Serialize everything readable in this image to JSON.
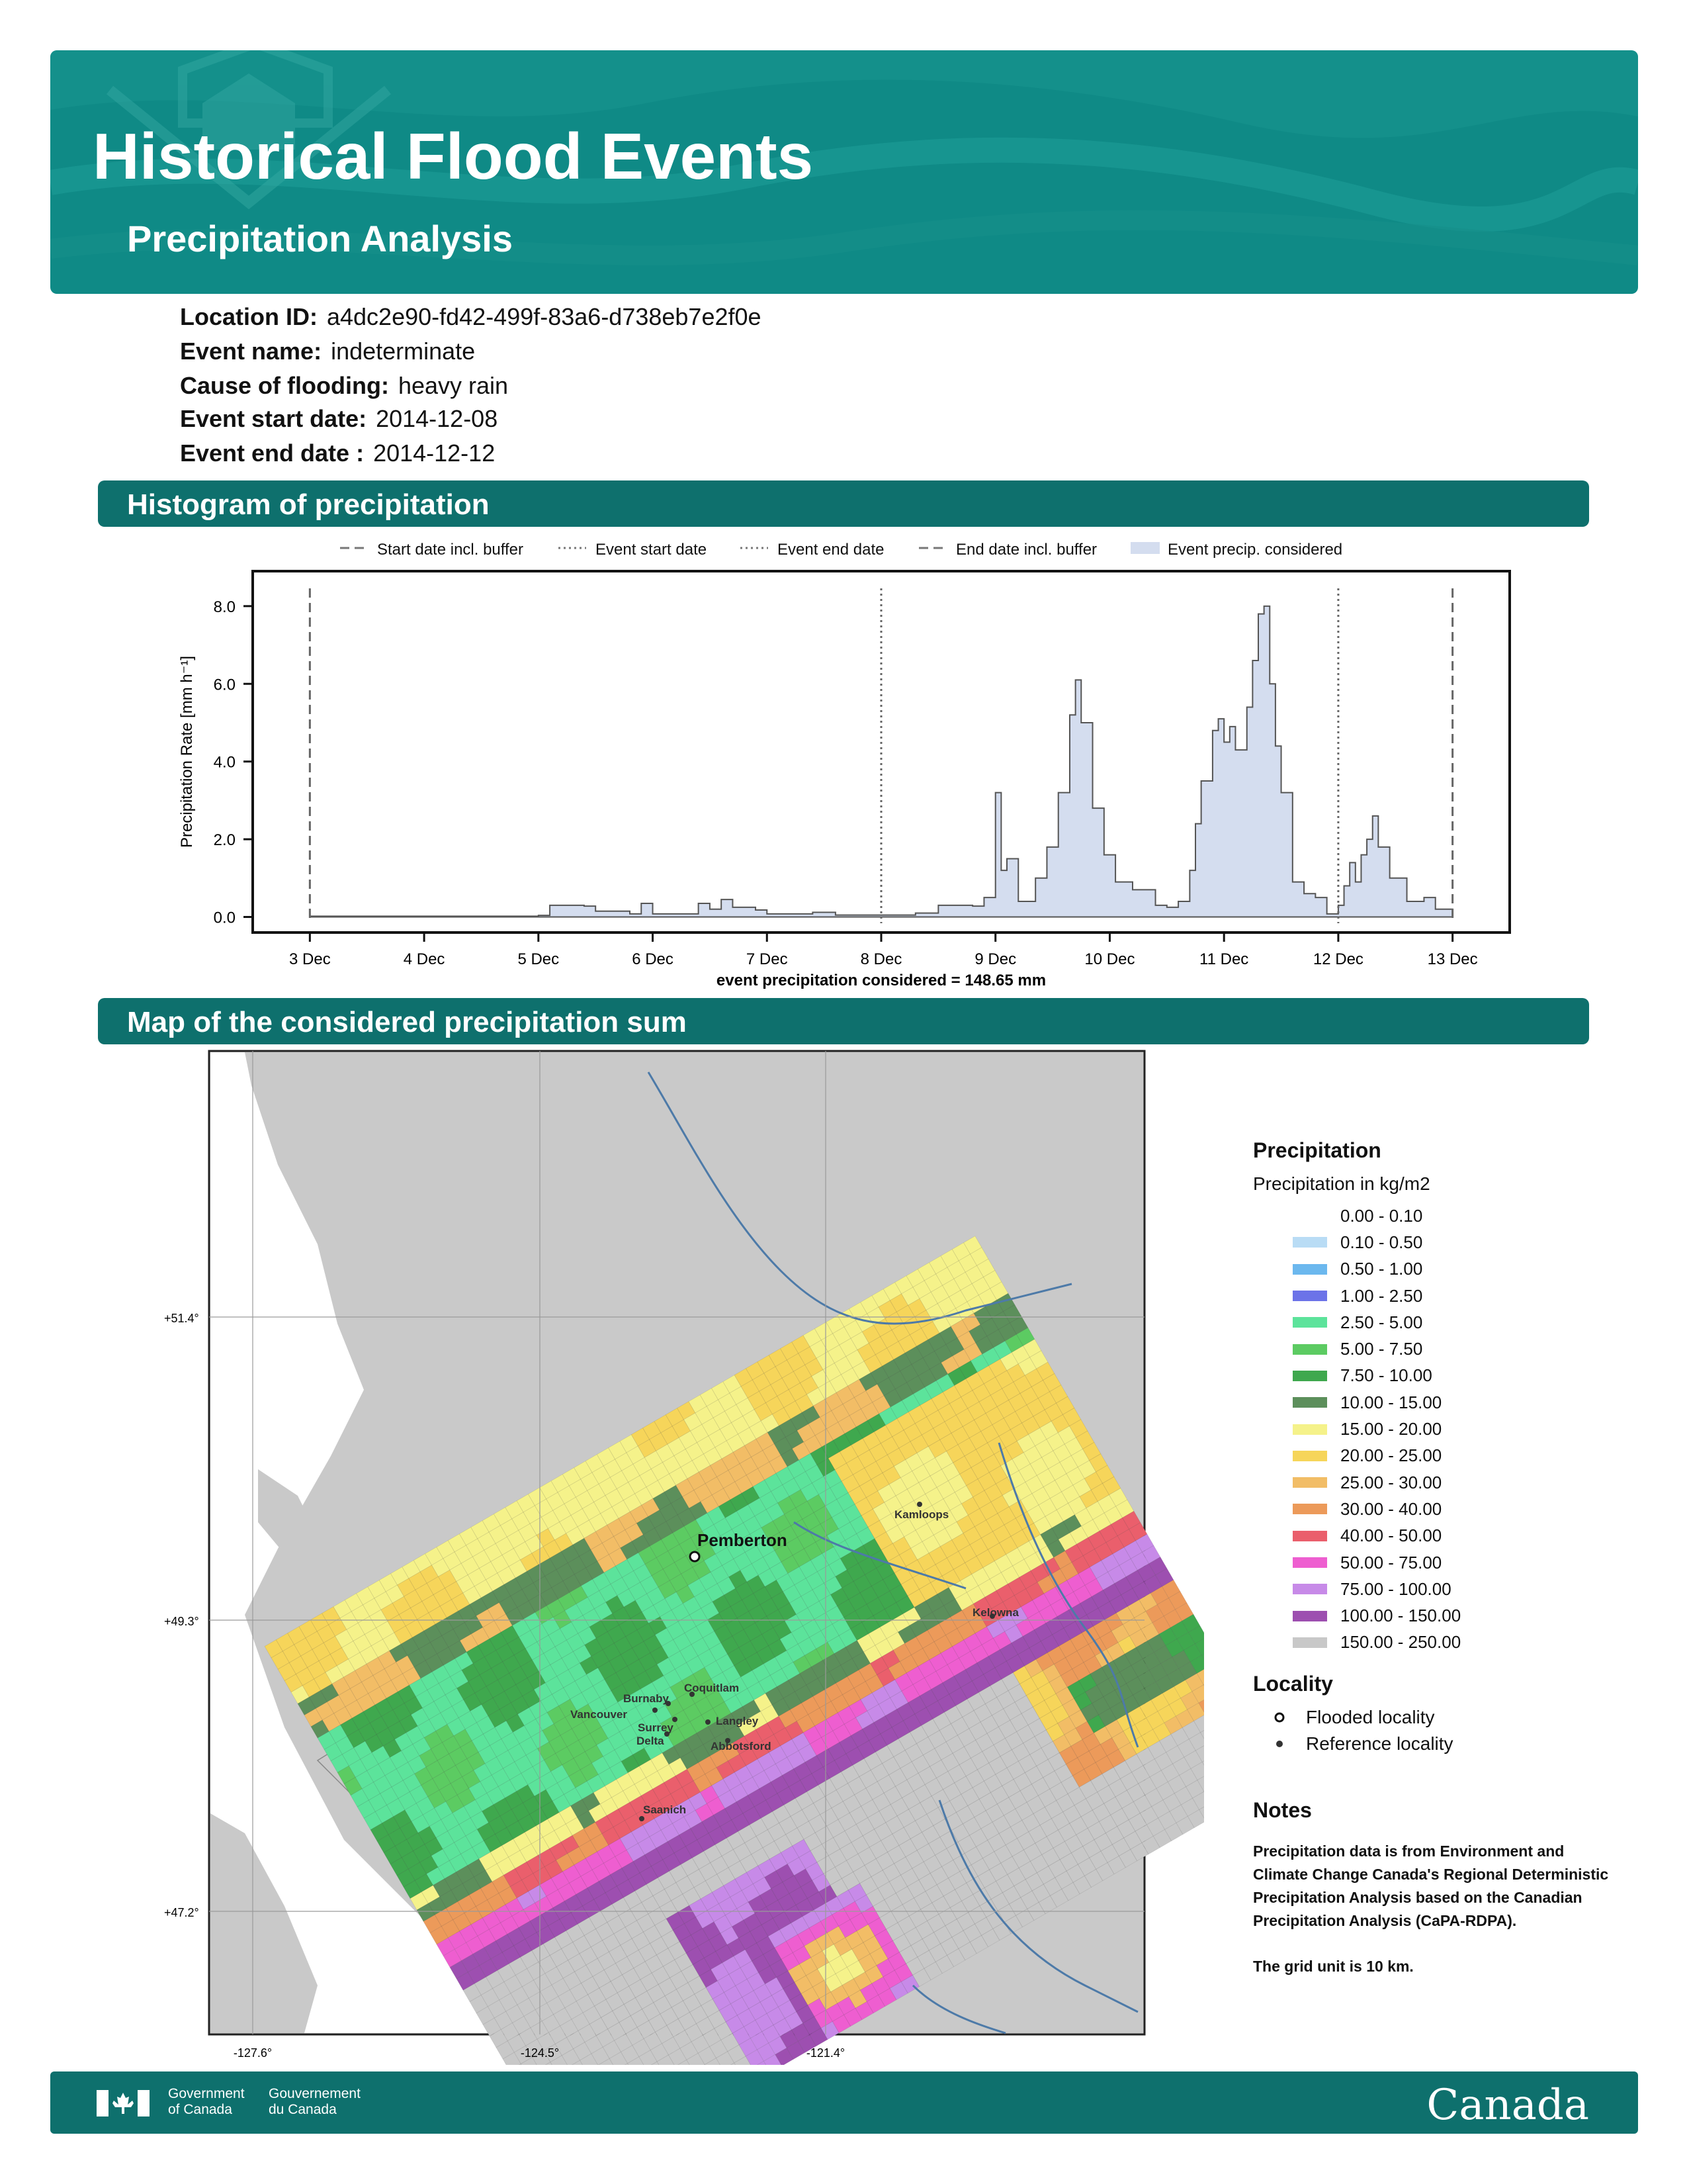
{
  "header": {
    "title": "Historical Flood Events",
    "subtitle": "Precipitation Analysis"
  },
  "event_info": [
    {
      "label": "Location ID:",
      "value": "a4dc2e90-fd42-499f-83a6-d738eb7e2f0e"
    },
    {
      "label": "Event name:",
      "value": "indeterminate"
    },
    {
      "label": "Cause of flooding:",
      "value": "heavy rain"
    },
    {
      "label": "Event start date:",
      "value": "2014-12-08"
    },
    {
      "label": "Event end date :",
      "value": "2014-12-12"
    }
  ],
  "sections": {
    "histogram": "Histogram of precipitation",
    "map": "Map of the considered precipitation sum"
  },
  "chart_data": {
    "type": "area",
    "legend": [
      "Start date incl. buffer",
      "Event start date",
      "Event end date",
      "End date incl. buffer",
      "Event precip. considered"
    ],
    "legend_position": "top",
    "ylabel": "Precipitation Rate [mm h⁻¹]",
    "xlabel": "event precipitation considered = 148.65 mm",
    "x_tick_labels": [
      "3 Dec",
      "4 Dec",
      "5 Dec",
      "6 Dec",
      "7 Dec",
      "8 Dec",
      "9 Dec",
      "10 Dec",
      "11 Dec",
      "12 Dec",
      "13 Dec"
    ],
    "y_tick_labels": [
      "0.0",
      "2.0",
      "4.0",
      "6.0",
      "8.0"
    ],
    "ylim": [
      -0.4,
      8.9
    ],
    "xlim": [
      -0.5,
      10.5
    ],
    "vlines": [
      {
        "label": "Start date incl. buffer",
        "day": 0,
        "style": "dashed"
      },
      {
        "label": "Event start date",
        "day": 5,
        "style": "dotted"
      },
      {
        "label": "Event end date",
        "day": 9,
        "style": "dotted"
      },
      {
        "label": "End date incl. buffer",
        "day": 10,
        "style": "dashed"
      }
    ],
    "series": [
      {
        "x_unit": "days from 3 Dec",
        "points": [
          [
            0,
            0.02
          ],
          [
            1,
            0.02
          ],
          [
            2,
            0.04
          ],
          [
            2.1,
            0.3
          ],
          [
            2.4,
            0.28
          ],
          [
            2.5,
            0.15
          ],
          [
            2.8,
            0.08
          ],
          [
            2.9,
            0.35
          ],
          [
            3.0,
            0.08
          ],
          [
            3.4,
            0.35
          ],
          [
            3.5,
            0.2
          ],
          [
            3.6,
            0.45
          ],
          [
            3.7,
            0.25
          ],
          [
            3.9,
            0.18
          ],
          [
            4.0,
            0.08
          ],
          [
            4.4,
            0.12
          ],
          [
            4.6,
            0.05
          ],
          [
            5,
            0.05
          ],
          [
            5.3,
            0.1
          ],
          [
            5.5,
            0.3
          ],
          [
            5.8,
            0.28
          ],
          [
            5.9,
            0.5
          ],
          [
            6.0,
            3.2
          ],
          [
            6.05,
            1.2
          ],
          [
            6.1,
            1.5
          ],
          [
            6.2,
            0.4
          ],
          [
            6.35,
            1.0
          ],
          [
            6.45,
            1.8
          ],
          [
            6.55,
            3.2
          ],
          [
            6.65,
            5.2
          ],
          [
            6.7,
            6.1
          ],
          [
            6.75,
            5.0
          ],
          [
            6.85,
            2.8
          ],
          [
            6.95,
            1.6
          ],
          [
            7.05,
            0.9
          ],
          [
            7.2,
            0.7
          ],
          [
            7.4,
            0.3
          ],
          [
            7.5,
            0.25
          ],
          [
            7.6,
            0.4
          ],
          [
            7.7,
            1.2
          ],
          [
            7.75,
            2.4
          ],
          [
            7.8,
            3.5
          ],
          [
            7.9,
            4.8
          ],
          [
            7.95,
            5.1
          ],
          [
            8.0,
            4.5
          ],
          [
            8.05,
            4.9
          ],
          [
            8.1,
            4.3
          ],
          [
            8.2,
            5.4
          ],
          [
            8.25,
            6.6
          ],
          [
            8.3,
            7.8
          ],
          [
            8.35,
            8.0
          ],
          [
            8.4,
            6.0
          ],
          [
            8.45,
            4.4
          ],
          [
            8.5,
            3.2
          ],
          [
            8.6,
            0.9
          ],
          [
            8.7,
            0.6
          ],
          [
            8.8,
            0.5
          ],
          [
            8.9,
            0.08
          ],
          [
            9.0,
            0.3
          ],
          [
            9.05,
            0.8
          ],
          [
            9.1,
            1.4
          ],
          [
            9.15,
            0.9
          ],
          [
            9.2,
            1.6
          ],
          [
            9.25,
            2.0
          ],
          [
            9.3,
            2.6
          ],
          [
            9.35,
            1.8
          ],
          [
            9.45,
            1.0
          ],
          [
            9.6,
            0.4
          ],
          [
            9.75,
            0.5
          ],
          [
            9.85,
            0.2
          ],
          [
            10,
            0.05
          ]
        ]
      }
    ]
  },
  "map": {
    "y_tick_labels": [
      "+51.4°",
      "+49.3°",
      "+47.2°"
    ],
    "x_tick_labels": [
      "-127.6°",
      "-124.5°",
      "-121.4°"
    ],
    "localities": [
      {
        "name": "Pemberton",
        "type": "flooded"
      },
      {
        "name": "Kamloops",
        "type": "reference"
      },
      {
        "name": "Kelowna",
        "type": "reference"
      },
      {
        "name": "Coquitlam",
        "type": "reference"
      },
      {
        "name": "Burnaby",
        "type": "reference"
      },
      {
        "name": "Vancouver",
        "type": "reference"
      },
      {
        "name": "Surrey",
        "type": "reference"
      },
      {
        "name": "Langley",
        "type": "reference"
      },
      {
        "name": "Delta",
        "type": "reference"
      },
      {
        "name": "Abbotsford",
        "type": "reference"
      },
      {
        "name": "Saanich",
        "type": "reference"
      }
    ]
  },
  "legend": {
    "title": "Precipitation",
    "subtitle": "Precipitation in kg/m2",
    "classes": [
      {
        "label": "0.00 - 0.10",
        "color": "#ffffff"
      },
      {
        "label": "0.10 - 0.50",
        "color": "#b9dcf5"
      },
      {
        "label": "0.50 - 1.00",
        "color": "#6cb8ee"
      },
      {
        "label": "1.00 - 2.50",
        "color": "#6c73e8"
      },
      {
        "label": "2.50 - 5.00",
        "color": "#5ce39b"
      },
      {
        "label": "5.00 - 7.50",
        "color": "#5ccb62"
      },
      {
        "label": "7.50 - 10.00",
        "color": "#3fa84e"
      },
      {
        "label": "10.00 - 15.00",
        "color": "#5c8f5b"
      },
      {
        "label": "15.00 - 20.00",
        "color": "#f5f28a"
      },
      {
        "label": "20.00 - 25.00",
        "color": "#f6d55a"
      },
      {
        "label": "25.00 - 30.00",
        "color": "#f2bd66"
      },
      {
        "label": "30.00 - 40.00",
        "color": "#ec9a5a"
      },
      {
        "label": "40.00 - 50.00",
        "color": "#ea5f6c"
      },
      {
        "label": "50.00 - 75.00",
        "color": "#ee5ed0"
      },
      {
        "label": "75.00 - 100.00",
        "color": "#c78ae8"
      },
      {
        "label": "100.00 - 150.00",
        "color": "#9d4fb0"
      },
      {
        "label": "150.00 - 250.00",
        "color": "#c8c8c8"
      }
    ],
    "locality_title": "Locality",
    "flooded_label": "Flooded locality",
    "reference_label": "Reference locality",
    "notes_title": "Notes",
    "notes_text": "Precipitation data is from Environment and Climate Change Canada's Regional Deterministic Precipitation Analysis based on the Canadian Precipitation Analysis (CaPA-RDPA).",
    "grid_note": "The grid unit is 10 km."
  },
  "footer": {
    "gov_en_1": "Government",
    "gov_en_2": "of Canada",
    "gov_fr_1": "Gouvernement",
    "gov_fr_2": "du Canada",
    "wordmark": "Canada"
  }
}
